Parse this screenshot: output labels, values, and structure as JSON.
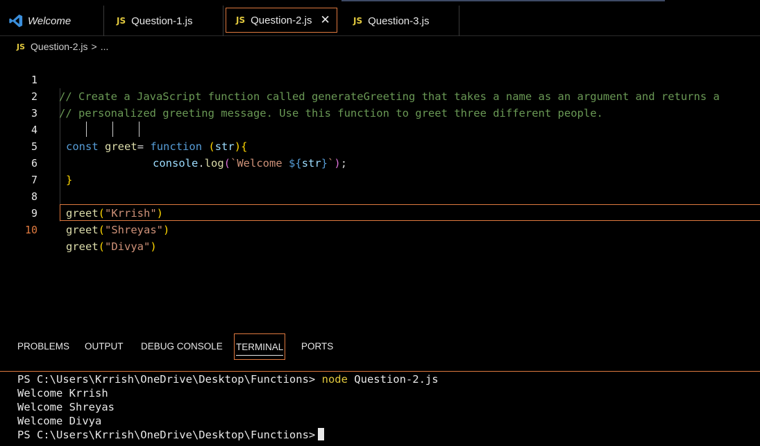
{
  "tabs": [
    {
      "label": "Welcome",
      "icon": "vscode-icon"
    },
    {
      "label": "Question-1.js",
      "icon": "js-file-icon"
    },
    {
      "label": "Question-2.js",
      "icon": "js-file-icon",
      "active": true
    },
    {
      "label": "Question-3.js",
      "icon": "js-file-icon"
    }
  ],
  "js_badge": "JS",
  "breadcrumb": {
    "file": "Question-2.js",
    "separator": ">",
    "more": "..."
  },
  "editor": {
    "line_numbers": [
      "1",
      "2",
      "3",
      "4",
      "5",
      "6",
      "7",
      "8",
      "9",
      "10"
    ],
    "current_line": "10",
    "comment1": "// Create a JavaScript function called generateGreeting that takes a name as an argument and returns a",
    "comment2": "// personalized greeting message. Use this function to greet three different people.",
    "l4": {
      "kw": "const",
      "name": "greet",
      "eq": "=",
      "fn": "function",
      "p1": "(",
      "param": "str",
      "p2": ")",
      "b": "{"
    },
    "l5": {
      "obj": "console",
      "dot": ".",
      "method": "log",
      "p1": "(",
      "tpl_start": "`Welcome ",
      "interp_open": "${",
      "interp_var": "str",
      "interp_close": "}",
      "tpl_end": "`",
      "p2": ")",
      "semi": ";"
    },
    "l6": {
      "b": "}"
    },
    "calls": [
      {
        "fn": "greet",
        "arg": "\"Krrish\""
      },
      {
        "fn": "greet",
        "arg": "\"Shreyas\""
      },
      {
        "fn": "greet",
        "arg": "\"Divya\""
      }
    ]
  },
  "panel": {
    "tabs": [
      "PROBLEMS",
      "OUTPUT",
      "DEBUG CONSOLE",
      "TERMINAL",
      "PORTS"
    ],
    "active_tab": "TERMINAL"
  },
  "terminal": {
    "prompt": "PS C:\\Users\\Krrish\\OneDrive\\Desktop\\Functions>",
    "command": "node",
    "command_arg": "Question-2.js",
    "output": [
      "Welcome Krrish",
      "Welcome Shreyas",
      "Welcome Divya"
    ]
  },
  "colors": {
    "accent": "#e07a3f",
    "js_badge": "#e2c93e",
    "comment": "#6a9955",
    "keyword": "#569cd6",
    "string": "#ce9178"
  }
}
